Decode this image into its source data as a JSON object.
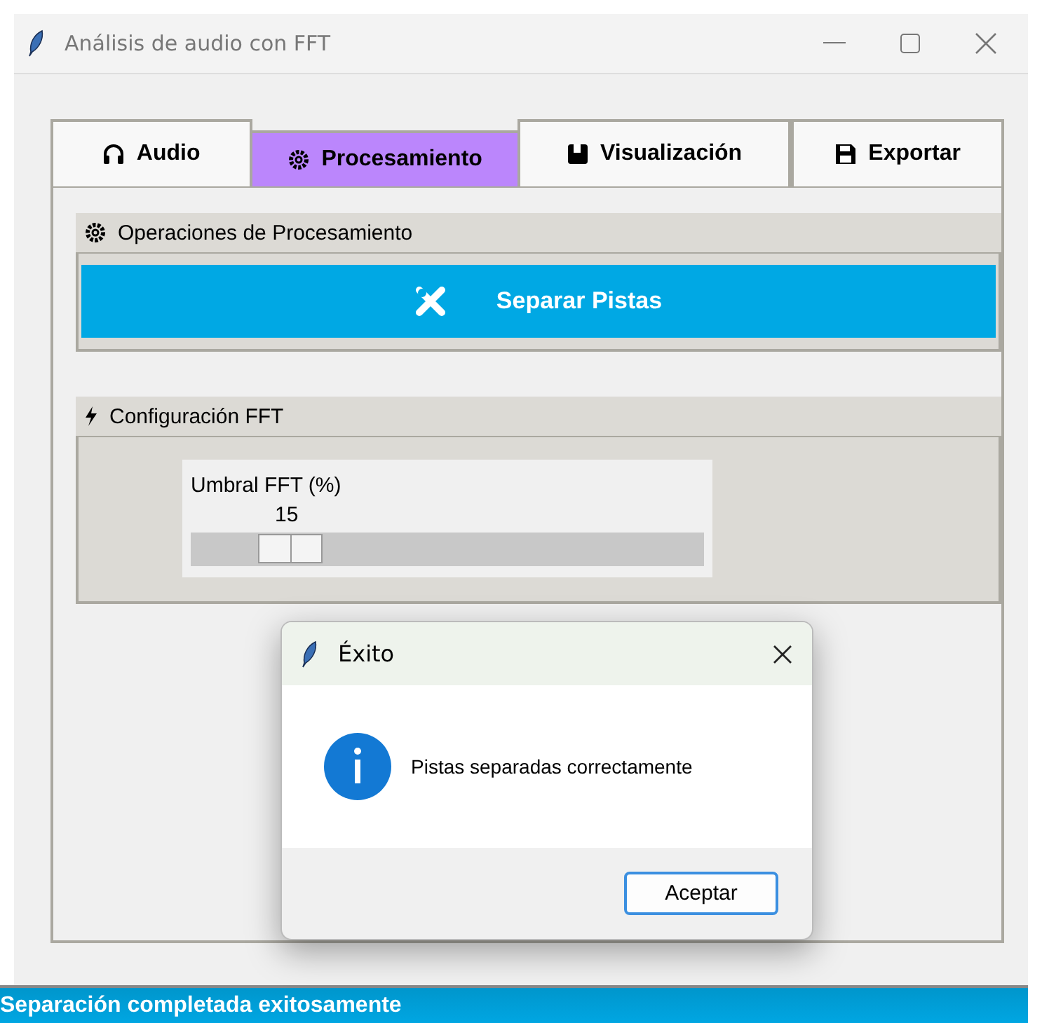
{
  "window": {
    "title": "Análisis de audio con FFT"
  },
  "tabs": [
    {
      "label": "Audio",
      "selected": false
    },
    {
      "label": "Procesamiento",
      "selected": true
    },
    {
      "label": "Visualización",
      "selected": false
    },
    {
      "label": "Exportar",
      "selected": false
    }
  ],
  "operations": {
    "title": "Operaciones de Procesamiento",
    "button": "Separar Pistas"
  },
  "fft_config": {
    "title": "Configuración FFT",
    "slider": {
      "label": "Umbral FFT (%)",
      "reading": "15",
      "level": 0.15
    }
  },
  "dialog": {
    "title": "Éxito",
    "message": "Pistas separadas correctamente",
    "button": "Aceptar"
  },
  "status_bar": "Separación completada exitosamente"
}
